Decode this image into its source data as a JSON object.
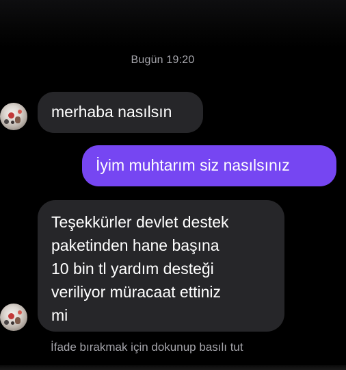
{
  "chat": {
    "timestamp": "Bugün 19:20",
    "messages": [
      {
        "direction": "incoming",
        "text": "merhaba nasılsın"
      },
      {
        "direction": "outgoing",
        "text": "İyim muhtarım siz nasılsınız"
      },
      {
        "direction": "incoming",
        "lines": [
          "Teşekkürler devlet destek",
          "paketinden hane başına",
          "10 bin tl yardım desteği",
          "veriliyor müracaat ettiniz",
          "mi"
        ]
      }
    ],
    "reaction_hint": "İfade bırakmak için dokunup basılı tut"
  },
  "colors": {
    "background": "#000000",
    "incoming_bubble": "#262629",
    "outgoing_bubble": "#7646f2",
    "secondary_text": "#a6a6ac"
  },
  "icons": {
    "avatar": "contact-avatar"
  }
}
